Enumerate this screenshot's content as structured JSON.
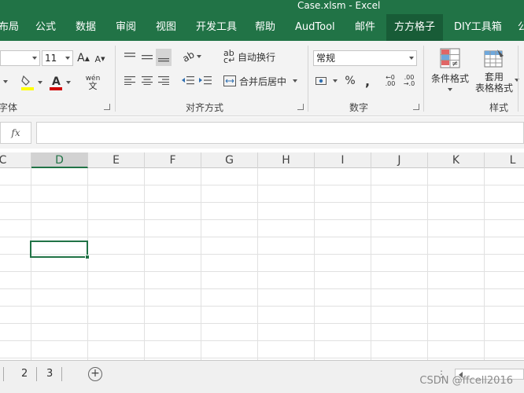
{
  "window": {
    "title": "Case.xlsm  -  Excel"
  },
  "tabs": [
    {
      "label": "布局"
    },
    {
      "label": "公式"
    },
    {
      "label": "数据"
    },
    {
      "label": "审阅"
    },
    {
      "label": "视图"
    },
    {
      "label": "开发工具"
    },
    {
      "label": "帮助"
    },
    {
      "label": "AudTool"
    },
    {
      "label": "邮件"
    },
    {
      "label": "方方格子",
      "active": true
    },
    {
      "label": "DIY工具箱"
    },
    {
      "label": "公"
    }
  ],
  "ribbon": {
    "font": {
      "size": "11",
      "group_label": "字体",
      "phonetic_label": "wén"
    },
    "alignment": {
      "wrap_text": "自动换行",
      "merge_center": "合并后居中",
      "group_label": "对齐方式"
    },
    "number": {
      "format": "常规",
      "percent": "%",
      "group_label": "数字"
    },
    "styles": {
      "conditional": "条件格式",
      "table_format_line1": "套用",
      "table_format_line2": "表格格式",
      "group_label": "样式"
    }
  },
  "formula_bar": {
    "fx_label": "fx",
    "value": ""
  },
  "columns": [
    "C",
    "D",
    "E",
    "F",
    "G",
    "H",
    "I",
    "J",
    "K",
    "L"
  ],
  "selected_column": "D",
  "sheets": {
    "items": [
      "2",
      "3"
    ],
    "add_label": "+"
  },
  "watermark": "CSDN @ffcell2016",
  "colors": {
    "accent": "#217346",
    "ribbon_bg": "#f3f3f3",
    "grid_line": "#e1e1e1"
  }
}
